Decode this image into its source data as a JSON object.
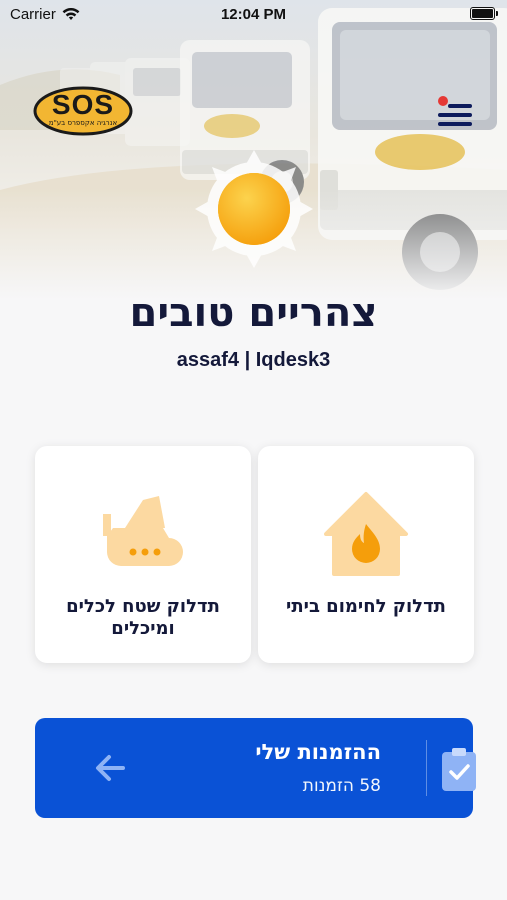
{
  "status_bar": {
    "carrier": "Carrier",
    "time": "12:04 PM"
  },
  "logo": {
    "text": "SOS",
    "subtitle": "אנרגיה אקספרס בע\"מ"
  },
  "greeting": {
    "title": "צהריים טובים",
    "user_line": "assaf4 | Iqdesk3"
  },
  "cards": [
    {
      "label": "תדלוק לחימום ביתי",
      "icon": "house-fire-icon"
    },
    {
      "label": "תדלוק שטח לכלים ומיכלים",
      "icon": "bulldozer-icon"
    }
  ],
  "orders": {
    "title": "ההזמנות שלי",
    "count": "58 הזמנות",
    "icon": "clipboard-check-icon"
  },
  "colors": {
    "primary": "#0a52d6",
    "accent": "#fbbf24",
    "text": "#14193a",
    "notification": "#e53935"
  }
}
